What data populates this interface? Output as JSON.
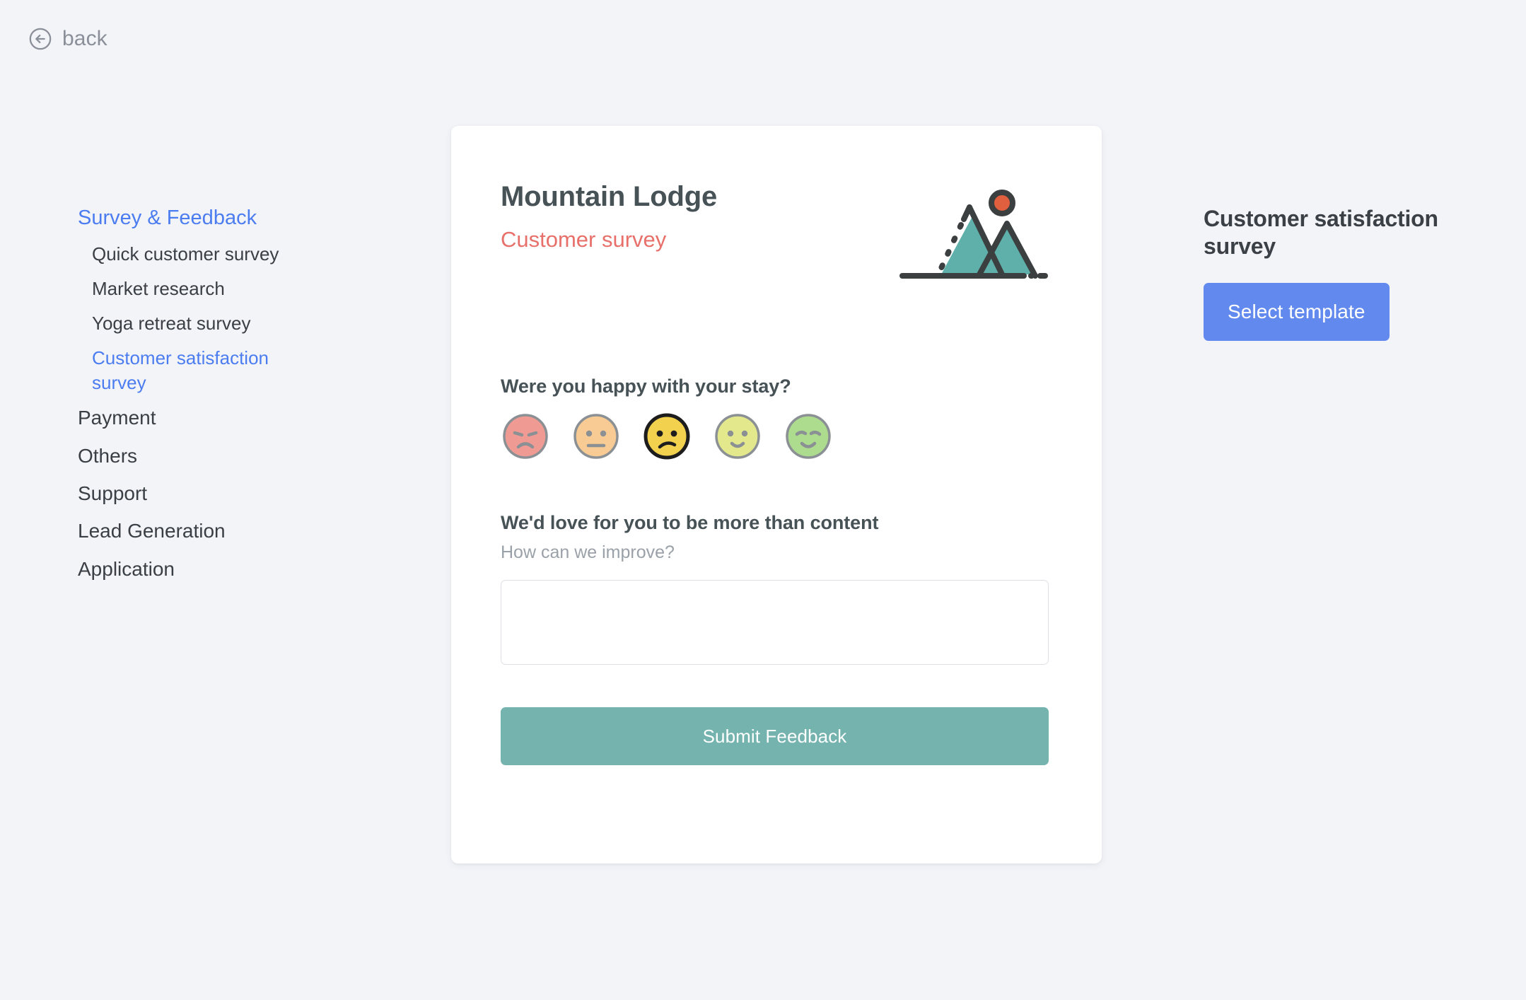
{
  "nav": {
    "back_label": "back",
    "back_icon": "arrow-left-circle-icon",
    "groups": [
      {
        "label": "Survey & Feedback",
        "active": true,
        "children": [
          {
            "label": "Quick customer survey",
            "active": false
          },
          {
            "label": "Market research",
            "active": false
          },
          {
            "label": "Yoga retreat survey",
            "active": false
          },
          {
            "label": "Customer satisfaction survey",
            "active": true
          }
        ]
      }
    ],
    "items": [
      {
        "label": "Payment"
      },
      {
        "label": "Others"
      },
      {
        "label": "Support"
      },
      {
        "label": "Lead Generation"
      },
      {
        "label": "Application"
      }
    ]
  },
  "card": {
    "brand_title": "Mountain Lodge",
    "brand_subtitle": "Customer survey",
    "logo_icon": "mountain-sun-logo-icon",
    "question_1": {
      "text": "Were you happy with your stay?",
      "selected_index": 2,
      "options": [
        {
          "name": "angry-face-icon",
          "mood": "angry",
          "fill": "#ef9a92",
          "value": 1
        },
        {
          "name": "neutral-face-icon",
          "mood": "neutral",
          "fill": "#f7cb93",
          "value": 2
        },
        {
          "name": "sad-face-icon",
          "mood": "sad",
          "fill": "#f2d14e",
          "value": 3
        },
        {
          "name": "smile-face-icon",
          "mood": "smile",
          "fill": "#e4e88c",
          "value": 4
        },
        {
          "name": "happy-face-icon",
          "mood": "happy",
          "fill": "#aedc8e",
          "value": 5
        }
      ]
    },
    "question_2": {
      "title": "We'd love for you to be more than content",
      "subtitle": "How can we improve?",
      "textarea_value": "",
      "textarea_placeholder": ""
    },
    "submit_label": "Submit Feedback"
  },
  "panel": {
    "title": "Customer satisfaction survey",
    "select_template_label": "Select template"
  },
  "colors": {
    "page_background": "#f3f4f8",
    "accent_blue": "#4c7df0",
    "button_blue": "#6289ee",
    "teal": "#74b3ae",
    "coral": "#e8706a",
    "text_dark": "#475257",
    "text_muted": "#9aa1a8",
    "selected_ring": "#1d1d1d",
    "unselected_ring": "#8b9094"
  }
}
